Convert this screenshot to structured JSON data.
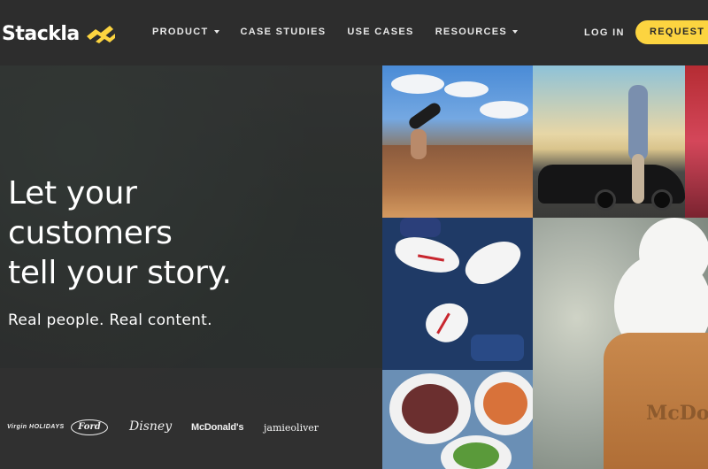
{
  "brand": {
    "name": "Stackla",
    "accent": "#fcd440"
  },
  "nav": {
    "items": [
      {
        "label": "PRODUCT",
        "dropdown": true
      },
      {
        "label": "CASE STUDIES",
        "dropdown": false
      },
      {
        "label": "USE CASES",
        "dropdown": false
      },
      {
        "label": "RESOURCES",
        "dropdown": true
      }
    ],
    "login": "LOG IN",
    "cta": "REQUEST A"
  },
  "hero": {
    "headline": [
      "Let your",
      "customers",
      "tell your story."
    ],
    "subline": "Real people. Real content."
  },
  "clients": [
    "Virgin HOLIDAYS",
    "Ford",
    "Disney",
    "McDonald's",
    "jamieoliver"
  ],
  "gallery": {
    "tiles": [
      "canyon-jump-photo",
      "car-sunset-photo",
      "red-balloon-photo",
      "sneakers-photo",
      "ice-cream-cone-photo",
      "food-plates-photo"
    ],
    "cone_text": "McDo"
  }
}
